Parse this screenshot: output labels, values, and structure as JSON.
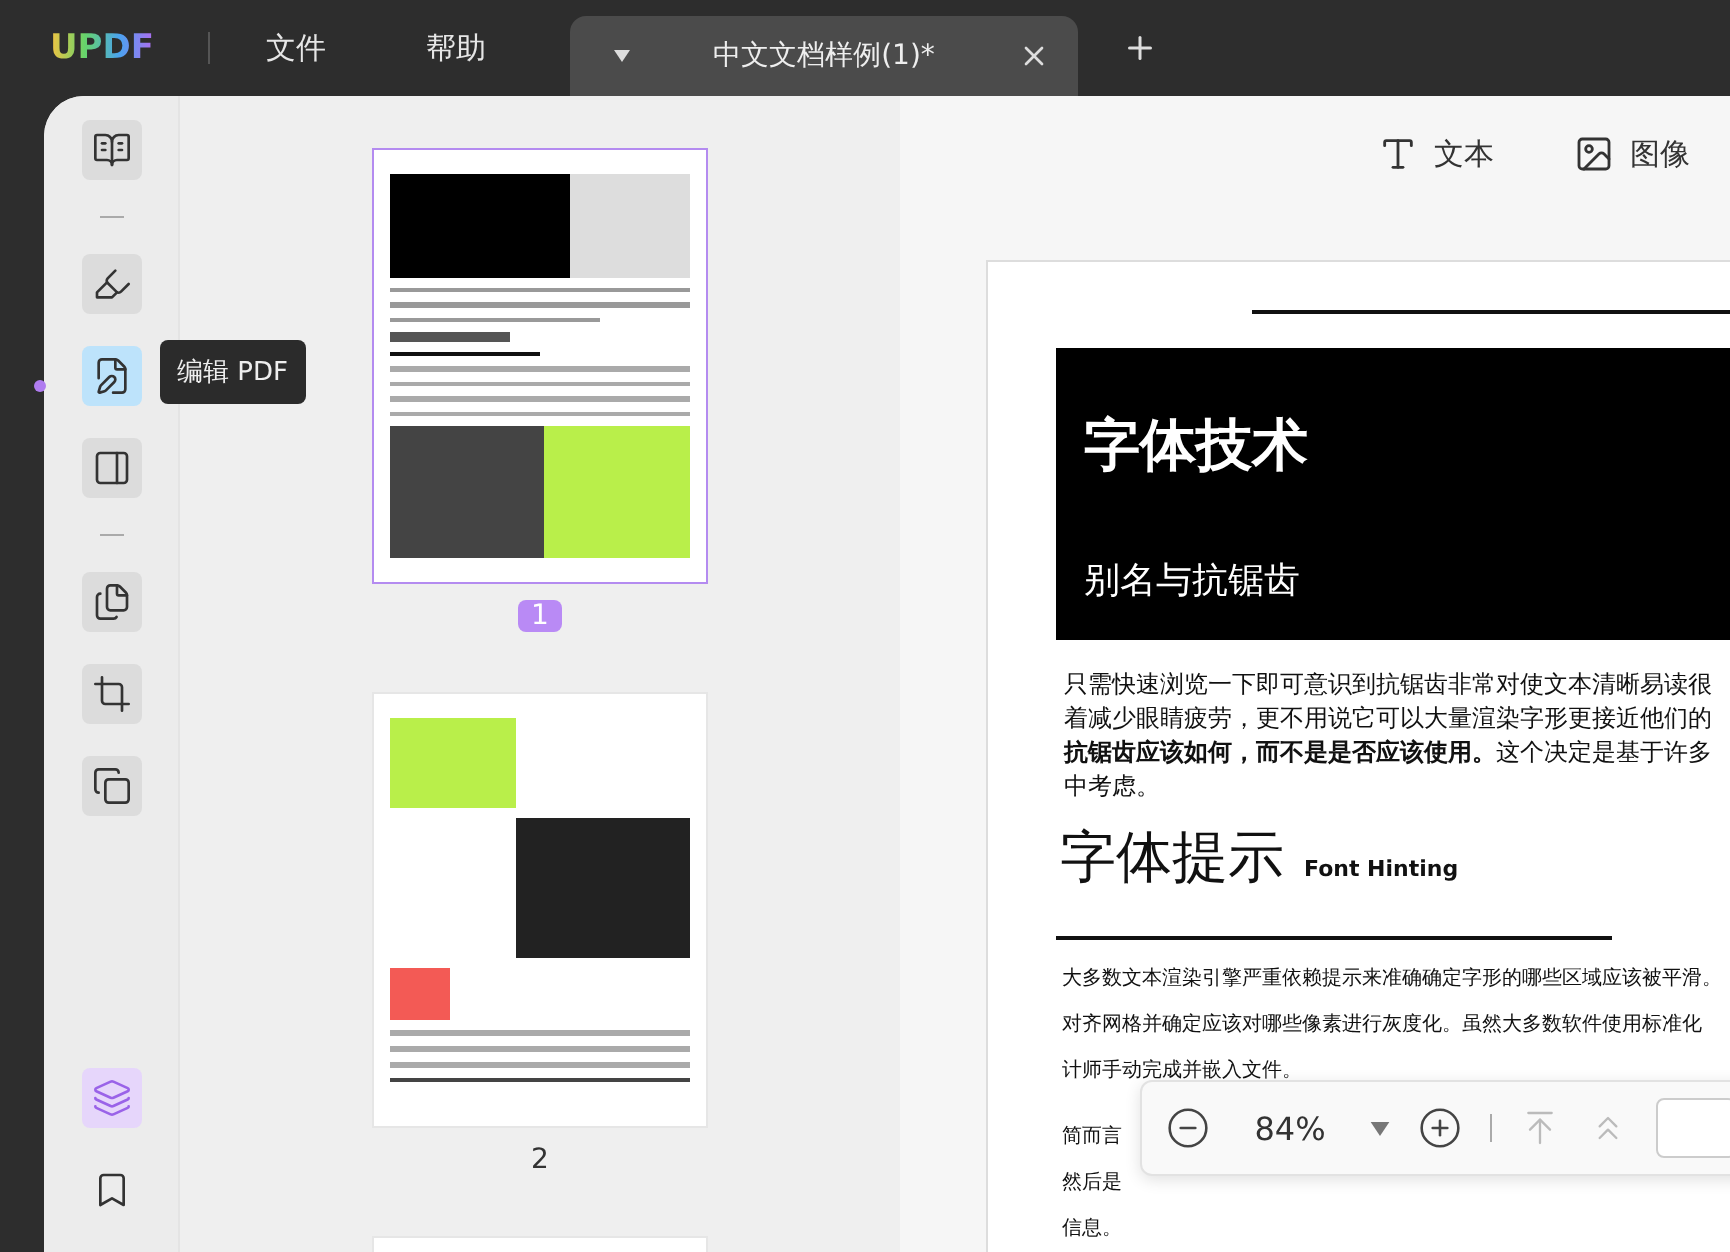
{
  "app": {
    "logo": "UPDF",
    "menu": [
      "文件",
      "帮助"
    ]
  },
  "tabs": [
    {
      "label": "中文文档样例(1)*",
      "selected": true
    }
  ],
  "sidebar": {
    "tooltip": "编辑 PDF",
    "tools": [
      {
        "kind": "tool",
        "selected": false
      },
      {
        "kind": "separator"
      },
      {
        "kind": "tool",
        "selected": false
      },
      {
        "kind": "tool",
        "selected": true
      },
      {
        "kind": "tool",
        "selected": false
      },
      {
        "kind": "separator"
      },
      {
        "kind": "tool",
        "selected": false
      },
      {
        "kind": "tool",
        "selected": false
      },
      {
        "kind": "tool",
        "selected": false
      }
    ],
    "bottom": [
      {
        "on": true
      },
      {
        "on": false
      }
    ]
  },
  "thumbnails": [
    {
      "page": "1",
      "selected": true
    },
    {
      "page": "2",
      "selected": false
    },
    {
      "selected": false
    }
  ],
  "toolbar": [
    "文本",
    "图像"
  ],
  "document": {
    "banner_title": "字体技术",
    "banner_subtitle": "别名与抗锯齿",
    "intro_lines": [
      "只需快速浏览一下即可意识到抗锯齿非常对使文本清晰易读很",
      "着减少眼睛疲劳，更不用说它可以大量渲染字形更接近他们的",
      "**抗锯齿应该如何，而不是是否应该使用。**这个决定是基于许多",
      "中考虑。"
    ],
    "heading": "字体提示",
    "heading_en": "Font Hinting",
    "body_lines": [
      "大多数文本渲染引擎严重依赖提示来准确确定字形的哪些区域应该被平滑。",
      "对齐网格并确定应该对哪些像素进行灰度化。虽然大多数软件使用标准化",
      "计师手动完成并嵌入文件。"
    ],
    "tail_lines": [
      "简而言",
      "然后是",
      "信息。"
    ]
  },
  "zoom_bar": {
    "zoom": "84%"
  }
}
